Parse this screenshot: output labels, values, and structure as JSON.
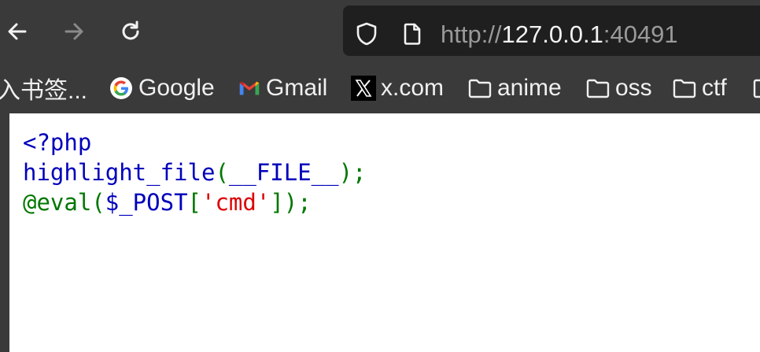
{
  "browser": {
    "url": {
      "scheme": "http://",
      "host": "127.0.0.1",
      "port": ":40491"
    },
    "nav": {
      "back_icon": "arrow-left-icon",
      "forward_icon": "arrow-right-icon",
      "reload_icon": "reload-icon",
      "shield_icon": "shield-icon",
      "page_icon": "page-icon"
    },
    "bookmarks": [
      {
        "label": "入书签...",
        "icon": "none"
      },
      {
        "label": "Google",
        "icon": "google-icon"
      },
      {
        "label": "Gmail",
        "icon": "gmail-icon"
      },
      {
        "label": "x.com",
        "icon": "x-icon"
      },
      {
        "label": "anime",
        "icon": "folder-icon"
      },
      {
        "label": "oss",
        "icon": "folder-icon"
      },
      {
        "label": "ctf",
        "icon": "folder-icon"
      }
    ]
  },
  "page": {
    "code": {
      "line1": {
        "open_tag": "<?php"
      },
      "line2": {
        "func": "highlight_file",
        "lparen": "(",
        "arg": "__FILE__",
        "rparen_semi": ");"
      },
      "line3": {
        "at_eval_lparen": "@eval(",
        "var": "$_POST",
        "lbracket": "[",
        "key": "'cmd'",
        "rbracket_semi": "]);"
      }
    }
  },
  "colors": {
    "php_default": "#0000bb",
    "php_keyword": "#007700",
    "php_string": "#dd0000",
    "toolbar_bg": "#3a3a3a",
    "urlbar_bg": "#1f1f1f"
  }
}
